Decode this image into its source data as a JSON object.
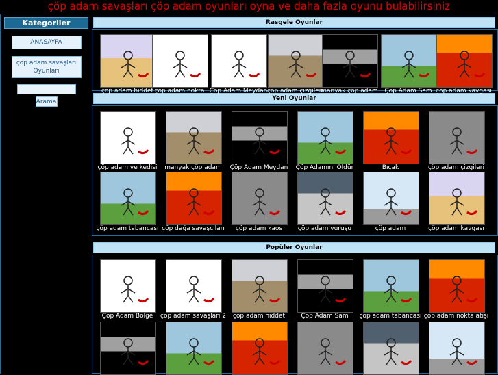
{
  "site_title": "çöp adam savaşları çöp adam oyunları oyna ve daha fazla oyunu bulabilirsiniz",
  "sidebar": {
    "header": "Kategoriler",
    "links": [
      "ANASAYFA",
      "çöp adam savaşları Oyunları"
    ],
    "search_value": "",
    "search_button": "Arama"
  },
  "sections": {
    "random": {
      "title": "Rasgele Oyunlar",
      "games": [
        "çöp adam hiddet",
        "çöp adam nokta",
        "Çöp Adam Meydan",
        "çöp adam çizgileri",
        "manyak çöp adam",
        "Çöp Adam Sam",
        "çöp adam kavgası"
      ]
    },
    "new": {
      "title": "Yeni Oyunlar",
      "games": [
        "çöp adam ve kedisi",
        "manyak çöp adam",
        "Çöp Adam Meydan",
        "Çöp Adamını Öldür",
        "Bıçak",
        "çöp adam çizgileri",
        "çöp adam tabancası",
        "çöp dağa savaşçıları",
        "çöp adam kaos",
        "çöp adam vuruşu",
        "çöp adam",
        "çöp adam kavgası"
      ]
    },
    "popular": {
      "title": "Popüler Oyunlar",
      "games": [
        "Çöp Adam Bölge",
        "çöp adam savaşları 2",
        "çöp adam hiddet",
        "Çöp Adam Sam",
        "çöp adam tabancası",
        "çöp adam nokta atışı",
        "",
        "",
        "",
        "",
        "",
        ""
      ]
    }
  },
  "colors": {
    "title_red": "#e00000",
    "header_blue": "#1c6a93",
    "section_light_blue": "#bfe3f6"
  }
}
